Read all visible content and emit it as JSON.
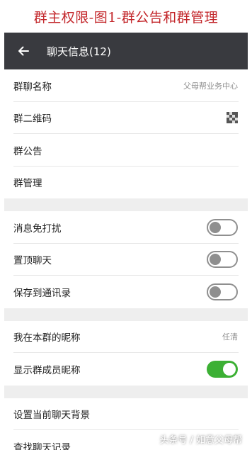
{
  "caption": "群主权限-图1-群公告和群管理",
  "appbar": {
    "title": "聊天信息(12)"
  },
  "group_info": [
    {
      "label": "群聊名称",
      "value": "父母帮业务中心"
    },
    {
      "label": "群二维码",
      "icon": "qr-code-icon"
    },
    {
      "label": "群公告"
    },
    {
      "label": "群管理"
    }
  ],
  "settings": [
    {
      "label": "消息免打扰",
      "toggle": false
    },
    {
      "label": "置顶聊天",
      "toggle": false
    },
    {
      "label": "保存到通讯录",
      "toggle": false
    }
  ],
  "nickname": [
    {
      "label": "我在本群的昵称",
      "value": "任清"
    },
    {
      "label": "显示群成员昵称",
      "toggle": true
    }
  ],
  "chat": [
    {
      "label": "设置当前聊天背景"
    },
    {
      "label": "查找聊天记录"
    }
  ],
  "watermark": "头条号 / 如意父母帮",
  "colors": {
    "accent_red": "#c3272b",
    "appbar": "#393a3f",
    "toggle_on": "#3cb034"
  }
}
